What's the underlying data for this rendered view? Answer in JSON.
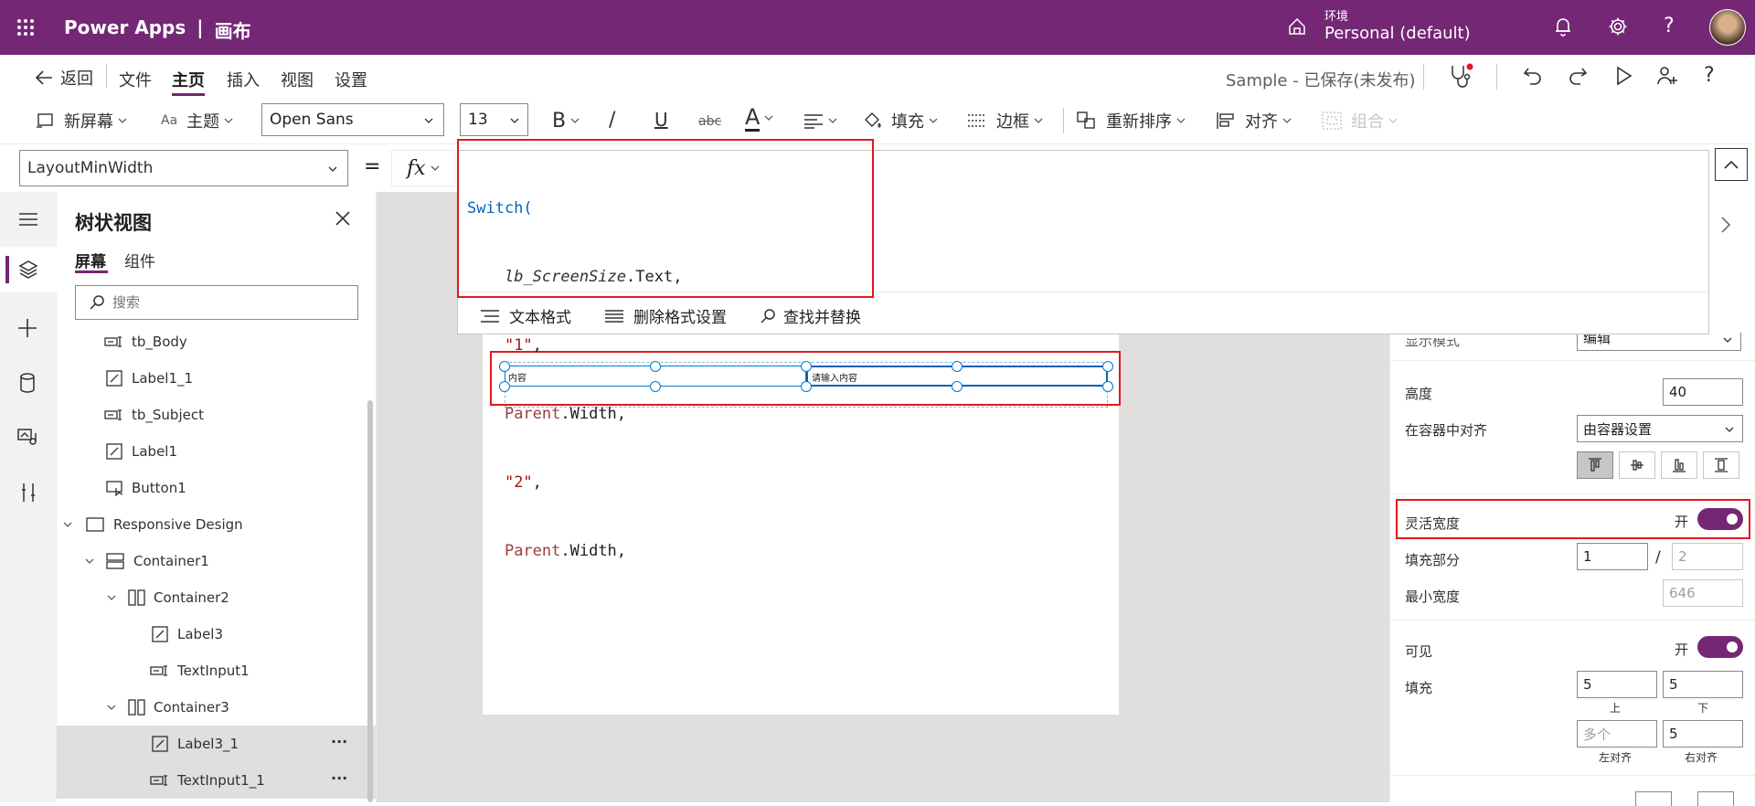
{
  "app": {
    "brand": "Power Apps",
    "separator": "|",
    "mode": "画布"
  },
  "env": {
    "label": "环境",
    "name": "Personal (default)"
  },
  "menubar": {
    "back": "返回",
    "file": "文件",
    "home": "主页",
    "insert": "插入",
    "view": "视图",
    "settings": "设置",
    "status": "Sample - 已保存(未发布)"
  },
  "toolbar": {
    "new_screen": "新屏幕",
    "theme": "主题",
    "font": "Open Sans",
    "font_size": "13",
    "bold": "B",
    "italic": "/",
    "underline": "U",
    "strike": "abc",
    "font_color": "A",
    "fill": "填充",
    "border": "边框",
    "reorder": "重新排序",
    "align": "对齐",
    "group": "组合"
  },
  "formula": {
    "property": "LayoutMinWidth",
    "equals": "=",
    "fx": "fx",
    "line1": "Switch(",
    "line2": "lb_ScreenSize",
    "line2b": ".Text,",
    "line3": "\"1\"",
    "line3b": ",",
    "line4": "Parent",
    "line4b": ".Width,",
    "line5": "\"2\"",
    "line5b": ",",
    "line6": "Parent",
    "line6b": ".Width,",
    "actions": {
      "format": "文本格式",
      "remove": "删除格式设置",
      "find": "查找并替换"
    }
  },
  "tree": {
    "title": "树状视图",
    "tabs": {
      "screens": "屏幕",
      "components": "组件"
    },
    "search_placeholder": "搜索",
    "items": [
      "tb_Body",
      "Label1_1",
      "tb_Subject",
      "Label1",
      "Button1",
      "Responsive Design",
      "Container1",
      "Container2",
      "Label3",
      "TextInput1",
      "Container3",
      "Label3_1",
      "TextInput1_1"
    ],
    "more": "···"
  },
  "canvas": {
    "label_text": "内容",
    "input_placeholder": "请输入内容"
  },
  "props": {
    "display_mode_label": "显示模式",
    "display_mode_value": "编辑",
    "height_label": "高度",
    "height_value": "40",
    "align_label": "在容器中对齐",
    "align_value": "由容器设置",
    "flex_label": "灵活宽度",
    "flex_state": "开",
    "fill_label": "填充部分",
    "fill_value": "1",
    "fill_slash": "/",
    "fill_total": "2",
    "minw_label": "最小宽度",
    "minw_value": "646",
    "visible_label": "可见",
    "visible_state": "开",
    "padding_label": "填充",
    "pad_top": "5",
    "pad_top_label": "上",
    "pad_bottom": "5",
    "pad_bottom_label": "下",
    "pad_left_placeholder": "多个",
    "pad_left_label": "左对齐",
    "pad_right": "5",
    "pad_right_label": "右对齐"
  },
  "colors": {
    "brand": "#742774",
    "highlight": "#e3171e",
    "selection": "#0078d4"
  }
}
